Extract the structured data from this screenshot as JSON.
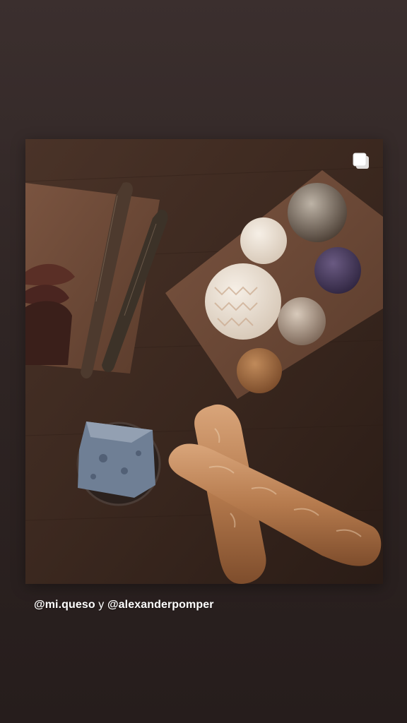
{
  "story": {
    "caption": {
      "mention_1": "@mi.queso",
      "conjunction": " y ",
      "mention_2": "@alexanderpomper"
    },
    "post_image": {
      "icon": "multiple-images-icon"
    }
  }
}
